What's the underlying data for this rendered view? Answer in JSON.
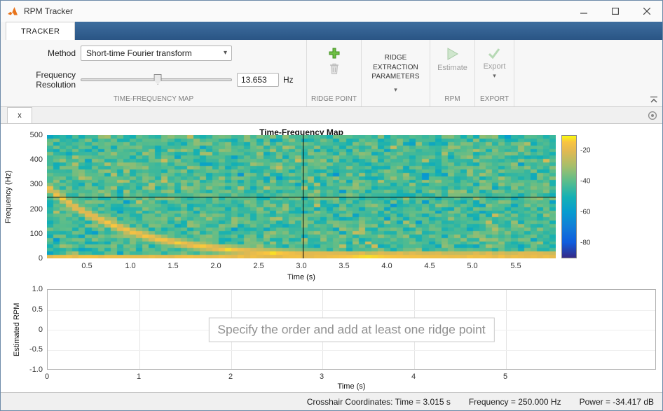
{
  "window": {
    "title": "RPM Tracker"
  },
  "tab_bar": {
    "tracker_tab": "TRACKER"
  },
  "toolstrip": {
    "method_label": "Method",
    "method_value": "Short-time Fourier transform",
    "freq_res_label": "Frequency Resolution",
    "freq_res_value": "13.653",
    "freq_res_unit": "Hz",
    "ridge_params_button": "RIDGE EXTRACTION PARAMETERS",
    "estimate_button": "Estimate",
    "export_button": "Export",
    "section_labels": {
      "tfmap": "TIME-FREQUENCY MAP",
      "ridge_point": "RIDGE POINT",
      "rpm": "RPM",
      "export": "EXPORT"
    }
  },
  "document_bar": {
    "tab_label": "x"
  },
  "tf_plot": {
    "title": "Time-Frequency Map",
    "xlabel": "Time (s)",
    "ylabel": "Frequency (Hz)",
    "xticks": [
      "0.5",
      "1.0",
      "1.5",
      "2.0",
      "2.5",
      "3.0",
      "3.5",
      "4.0",
      "4.5",
      "5.0",
      "5.5"
    ],
    "yticks": [
      "500",
      "400",
      "300",
      "200",
      "100",
      "0"
    ],
    "colorbar_ticks": [
      "-20",
      "-40",
      "-60",
      "-80"
    ]
  },
  "rpm_plot": {
    "xlabel": "Time (s)",
    "ylabel": "Estimated RPM",
    "xticks": [
      "0",
      "1",
      "2",
      "3",
      "4",
      "5"
    ],
    "yticks": [
      "1.0",
      "0.5",
      "0",
      "-0.5",
      "-1.0"
    ],
    "placeholder_message": "Specify the order and add at least one ridge point"
  },
  "status_bar": {
    "crosshair_label": "Crosshair Coordinates: Time = 3.015 s",
    "frequency_label": "Frequency = 250.000 Hz",
    "power_label": "Power = -34.417 dB"
  },
  "icons": {
    "chevron_down": "▾"
  },
  "chart_data": {
    "type": "heatmap",
    "title": "Time-Frequency Map",
    "xlabel": "Time (s)",
    "ylabel": "Frequency (Hz)",
    "time_range": [
      0.03,
      5.97
    ],
    "freq_range": [
      0,
      500
    ],
    "db_range": [
      -90,
      -10
    ],
    "colorbar_ticks": [
      -20,
      -40,
      -60,
      -80
    ],
    "bins_time": 80,
    "bins_freq": 36,
    "ridge": {
      "type": "exponential-decay",
      "f0_hz": 300,
      "tau_s": 1.0
    },
    "crosshair": {
      "time_s": 3.015,
      "frequency_hz": 250.0,
      "power_db": -34.417
    },
    "colormap": [
      [
        0.0,
        53,
        42,
        135
      ],
      [
        0.125,
        15,
        92,
        221
      ],
      [
        0.25,
        18,
        125,
        216
      ],
      [
        0.375,
        7,
        156,
        207
      ],
      [
        0.5,
        21,
        177,
        180
      ],
      [
        0.625,
        89,
        189,
        140
      ],
      [
        0.75,
        165,
        190,
        107
      ],
      [
        0.875,
        225,
        185,
        82
      ],
      [
        0.95,
        249,
        196,
        65
      ],
      [
        1.0,
        249,
        251,
        14
      ]
    ]
  }
}
